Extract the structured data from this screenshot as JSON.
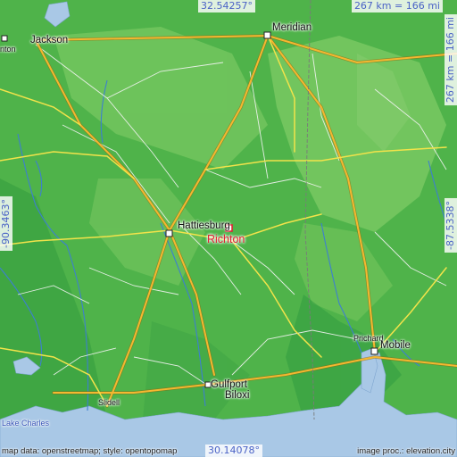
{
  "coordinates": {
    "top_lat": "32.54257°",
    "bottom_lat": "30.14078°",
    "left_lon": "-90.3463°",
    "right_lon": "-87.5338°"
  },
  "scale": {
    "horizontal": "267 km = 166 mi",
    "vertical": "267 km = 166 mi"
  },
  "cities": {
    "jackson": "Jackson",
    "clinton": "nton",
    "meridian": "Meridian",
    "hattiesburg": "Hattiesburg",
    "richton": "Richton",
    "prichard": "Prichard",
    "mobile": "Mobile",
    "gulfport": "Gulfport",
    "biloxi": "Biloxi",
    "slidell": "Slidell",
    "lake_charles": "Lake Charles"
  },
  "credits": {
    "left": "map data: openstreetmap; style: opentopomap",
    "right": "image proc.: elevation.city"
  },
  "colors": {
    "land": "#4fb34a",
    "water": "#a9c8e6",
    "highlight_city": "#e02030",
    "coordinate_text": "#4a62c6"
  }
}
